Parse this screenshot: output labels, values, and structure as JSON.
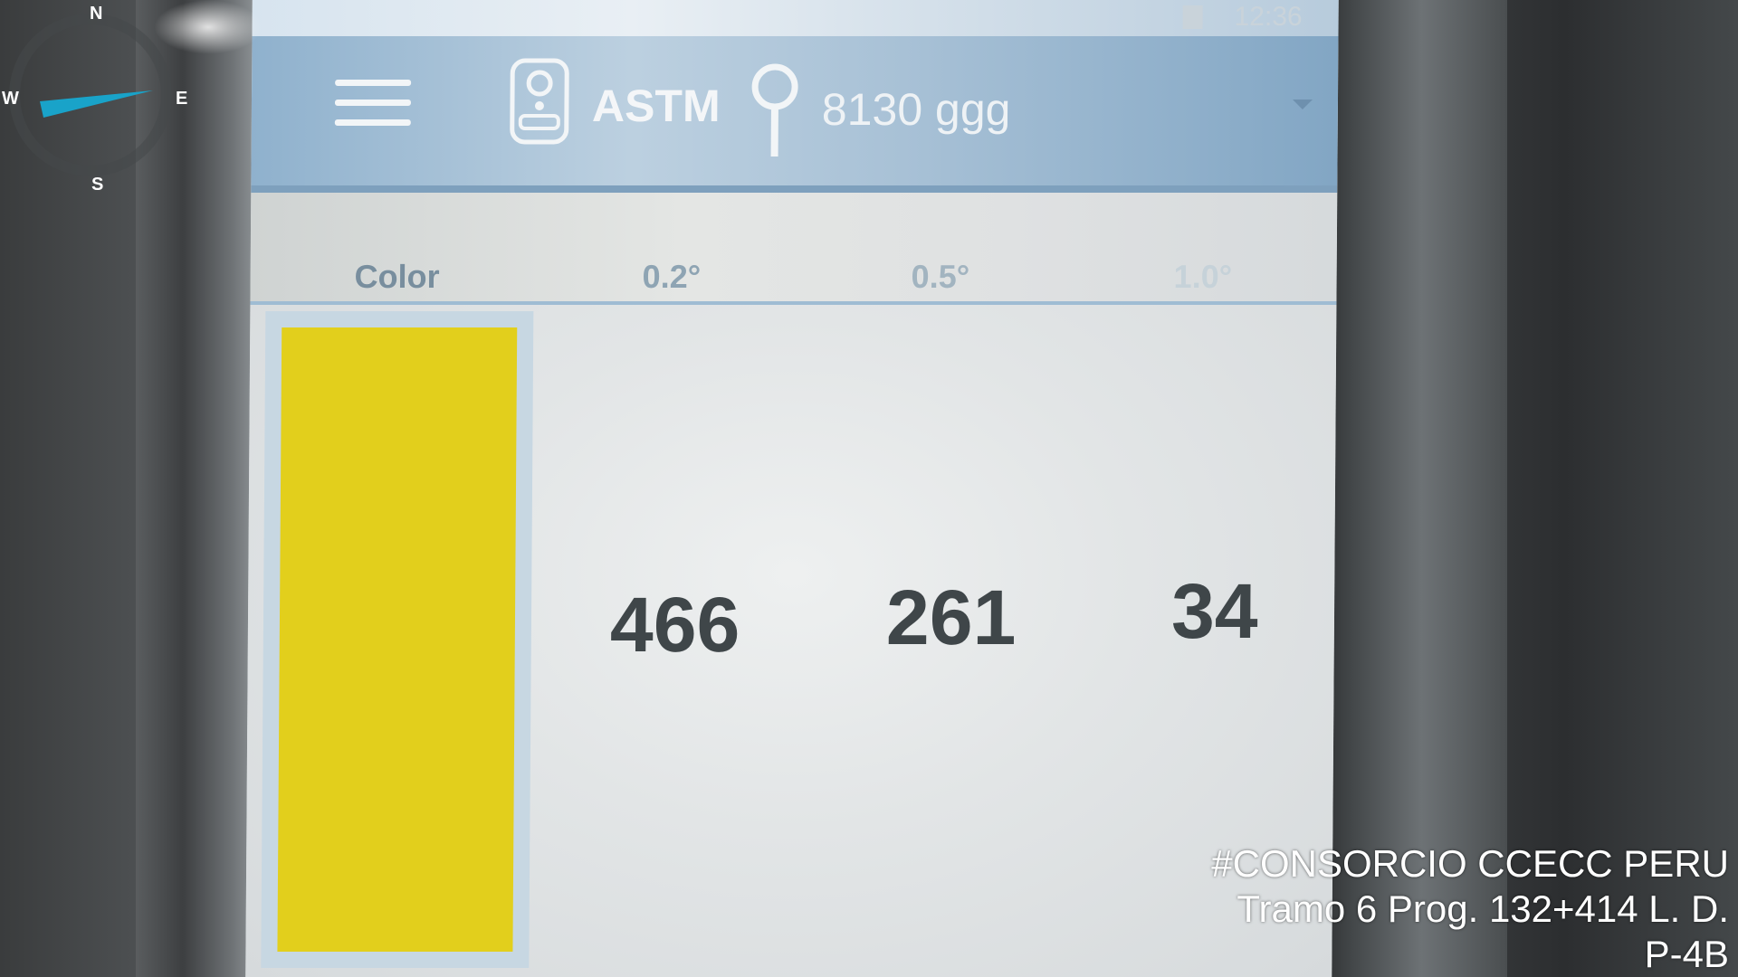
{
  "status_bar": {
    "time": "12:36"
  },
  "app_bar": {
    "menu_icon": "hamburger-menu-icon",
    "device_icon": "retroreflectometer-icon",
    "mode": "ASTM",
    "location_icon": "map-pin-icon",
    "location": "8130 ggg",
    "dropdown_icon": "chevron-down-icon"
  },
  "table": {
    "headers": [
      "Color",
      "0.2°",
      "0.5°",
      "1.0°"
    ],
    "measured_color": "#e2cf1c",
    "values": [
      "466",
      "261",
      "34"
    ]
  },
  "compass": {
    "n": "N",
    "s": "S",
    "e": "E",
    "w": "W",
    "needle_color": "#19a3c9"
  },
  "watermark": {
    "line1": "#CONSORCIO CCECC PERU",
    "line2": "Tramo 6 Prog. 132+414 L. D.",
    "line3": "P-4B"
  }
}
